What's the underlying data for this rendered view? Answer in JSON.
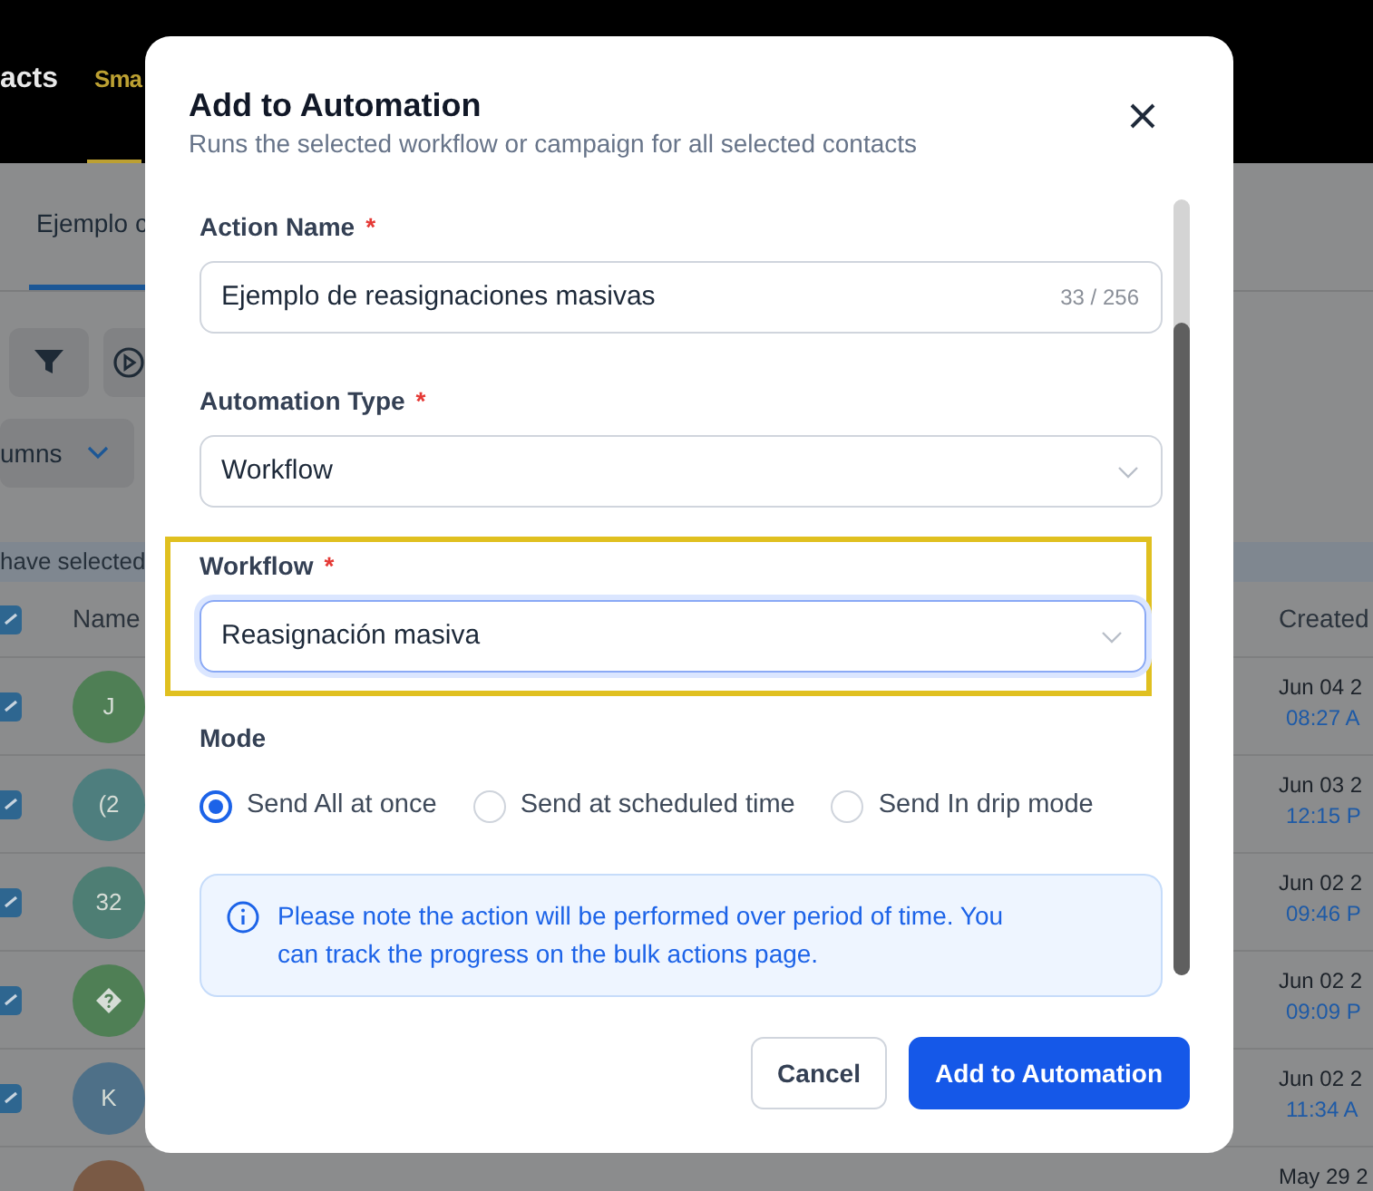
{
  "header_tabs": [
    {
      "label": "acts",
      "selected": false
    },
    {
      "label": "Sma",
      "selected": true
    }
  ],
  "view_tab": {
    "label": "Ejemplo c",
    "selected": true
  },
  "columns_button": "umns",
  "selection_note": "have selected",
  "table": {
    "columns": [
      "Name",
      "Created"
    ],
    "header_checked": true,
    "rows": [
      {
        "kind": "initials",
        "checked": true,
        "avatar": "J",
        "color": "#4f7f55",
        "created_date": "Jun 04 2",
        "created_time": "08:27 A"
      },
      {
        "kind": "initials",
        "checked": true,
        "avatar": "(2",
        "color": "#4e7e7e",
        "created_date": "Jun 03 2",
        "created_time": "12:15 P"
      },
      {
        "kind": "initials",
        "checked": true,
        "avatar": "32",
        "color": "#4e7e74",
        "created_date": "Jun 02 2",
        "created_time": "09:46 P"
      },
      {
        "kind": "icon",
        "checked": true,
        "color": "#4f7f55",
        "created_date": "Jun 02 2",
        "created_time": "09:09 P"
      },
      {
        "kind": "initials",
        "checked": true,
        "avatar": "K",
        "color": "#4e7088",
        "created_date": "Jun 02 2",
        "created_time": "11:34 A"
      },
      {
        "kind": "initials",
        "color": "#7a5a45",
        "created_date": "May 29 2"
      }
    ]
  },
  "modal": {
    "title": "Add to Automation",
    "subtitle": "Runs the selected workflow or campaign for all selected contacts",
    "fields": [
      {
        "kind": "text",
        "label": "Action Name",
        "required_mark": "*",
        "value": "Ejemplo de reasignaciones masivas",
        "counter": "33 / 256",
        "focused": false,
        "highlighted": false
      },
      {
        "kind": "select",
        "label": "Automation Type",
        "required_mark": "*",
        "value": "Workflow",
        "focused": false,
        "highlighted": false
      },
      {
        "kind": "select",
        "label": "Workflow",
        "required_mark": "*",
        "value": "Reasignación masiva",
        "focused": true,
        "highlighted": true
      }
    ],
    "mode": {
      "label": "Mode",
      "options": [
        {
          "label": "Send All at once",
          "selected": true
        },
        {
          "label": "Send at scheduled time",
          "selected": false
        },
        {
          "label": "Send In drip mode",
          "selected": false
        }
      ]
    },
    "notice": "Please note the action will be performed over period of time. You can track the progress on the bulk actions page.",
    "buttons": [
      {
        "label": "Cancel",
        "kind": "secondary"
      },
      {
        "label": "Add to Automation",
        "kind": "primary"
      }
    ]
  }
}
